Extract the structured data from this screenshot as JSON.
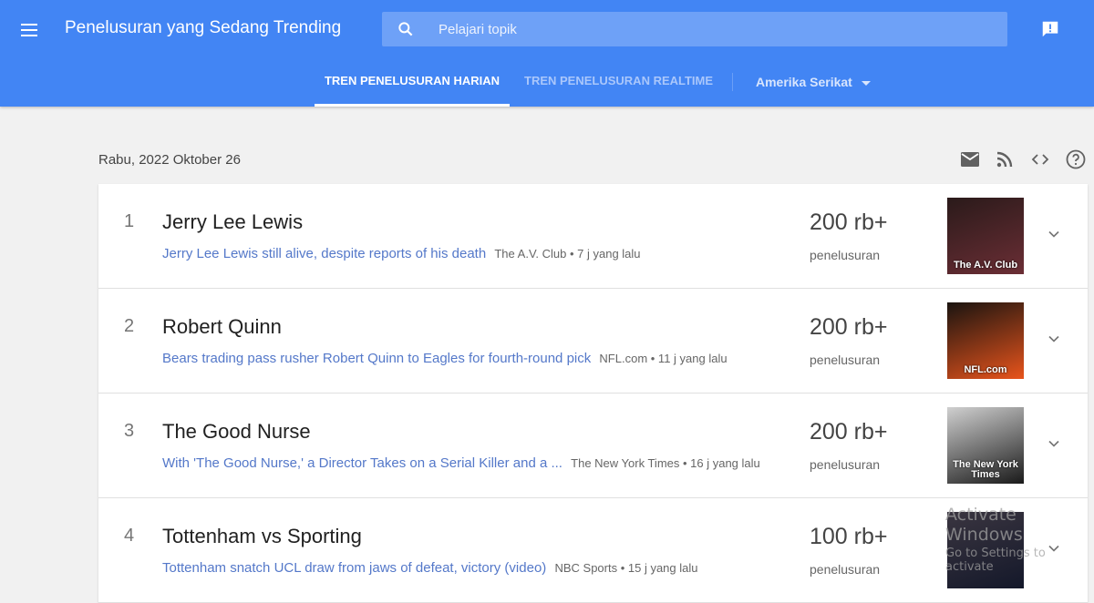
{
  "header": {
    "menu_icon": "hamburger-menu-icon",
    "title": "Penelusuran yang Sedang Trending",
    "search": {
      "placeholder": "Pelajari topik",
      "value": "",
      "icon": "search-icon"
    },
    "feedback_icon": "feedback-icon"
  },
  "tabs": [
    {
      "label": "TREN PENELUSURAN HARIAN",
      "active": true
    },
    {
      "label": "TREN PENELUSURAN REALTIME",
      "active": false
    }
  ],
  "region": {
    "label": "Amerika Serikat",
    "icon": "dropdown-caret-icon"
  },
  "date": "Rabu, 2022 Oktober 26",
  "actions": [
    "email-icon",
    "rss-icon",
    "embed-code-icon",
    "help-icon"
  ],
  "trends": [
    {
      "rank": "1",
      "title": "Jerry Lee Lewis",
      "article": "Jerry Lee Lewis still alive, despite reports of his death",
      "meta": "The A.V. Club • 7 j yang lalu",
      "count": "200 rb+",
      "count_label": "penelusuran",
      "thumb_source": "The A.V. Club",
      "thumb_colors": [
        "#2a1a1a",
        "#6b2e35"
      ]
    },
    {
      "rank": "2",
      "title": "Robert Quinn",
      "article": "Bears trading pass rusher Robert Quinn to Eagles for fourth-round pick",
      "meta": "NFL.com • 11 j yang lalu",
      "count": "200 rb+",
      "count_label": "penelusuran",
      "thumb_source": "NFL.com",
      "thumb_colors": [
        "#1a1410",
        "#e8541c"
      ]
    },
    {
      "rank": "3",
      "title": "The Good Nurse",
      "article": "With 'The Good Nurse,' a Director Takes on a Serial Killer and a ...",
      "meta": "The New York Times • 16 j yang lalu",
      "count": "200 rb+",
      "count_label": "penelusuran",
      "thumb_source": "The New York Times",
      "thumb_colors": [
        "#d0d0d0",
        "#1a1a1a"
      ]
    },
    {
      "rank": "4",
      "title": "Tottenham vs Sporting",
      "article": "Tottenham snatch UCL draw from jaws of defeat, victory (video)",
      "meta": "NBC Sports • 15 j yang lalu",
      "count": "100 rb+",
      "count_label": "penelusuran",
      "thumb_source": "",
      "thumb_colors": [
        "#3a3540",
        "#14182a"
      ]
    }
  ],
  "watermark": {
    "line1": "Activate Windows",
    "line2": "Go to Settings to activate"
  }
}
